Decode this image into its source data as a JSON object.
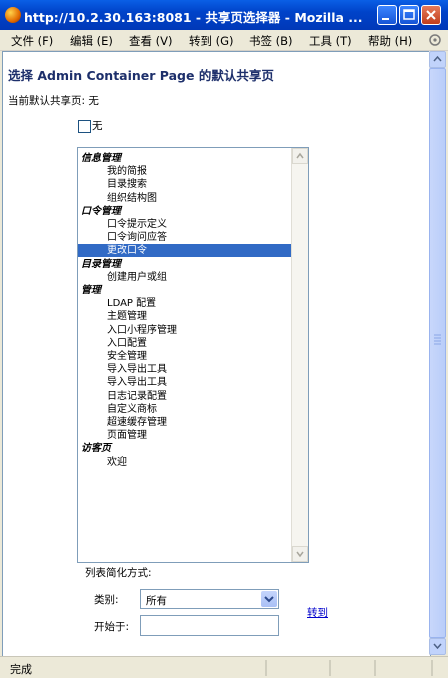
{
  "window": {
    "title": "http://10.2.30.163:8081 - 共享页选择器 - Mozilla ..."
  },
  "menu": [
    {
      "label": "文件 (F)"
    },
    {
      "label": "编辑 (E)"
    },
    {
      "label": "查看 (V)"
    },
    {
      "label": "转到 (G)"
    },
    {
      "label": "书签 (B)"
    },
    {
      "label": "工具 (T)"
    },
    {
      "label": "帮助 (H)"
    }
  ],
  "page": {
    "heading": "选择 Admin Container Page 的默认共享页",
    "current_default": "当前默认共享页: 无",
    "none_label": "无"
  },
  "list": [
    {
      "text": "信息管理",
      "kind": "group"
    },
    {
      "text": "我的简报",
      "kind": "child"
    },
    {
      "text": "目录搜索",
      "kind": "child"
    },
    {
      "text": "组织结构图",
      "kind": "child"
    },
    {
      "text": "口令管理",
      "kind": "group"
    },
    {
      "text": "口令提示定义",
      "kind": "child"
    },
    {
      "text": "口令询问应答",
      "kind": "child"
    },
    {
      "text": "更改口令",
      "kind": "child",
      "selected": true
    },
    {
      "text": "目录管理",
      "kind": "group"
    },
    {
      "text": "创建用户或组",
      "kind": "child"
    },
    {
      "text": "管理",
      "kind": "group"
    },
    {
      "text": "LDAP 配置",
      "kind": "child"
    },
    {
      "text": "主题管理",
      "kind": "child"
    },
    {
      "text": "入口小程序管理",
      "kind": "child"
    },
    {
      "text": "入口配置",
      "kind": "child"
    },
    {
      "text": "安全管理",
      "kind": "child"
    },
    {
      "text": "导入导出工具",
      "kind": "child"
    },
    {
      "text": "导入导出工具",
      "kind": "child"
    },
    {
      "text": "日志记录配置",
      "kind": "child"
    },
    {
      "text": "自定义商标",
      "kind": "child"
    },
    {
      "text": "超速缓存管理",
      "kind": "child"
    },
    {
      "text": "页面管理",
      "kind": "child"
    },
    {
      "text": "访客页",
      "kind": "group"
    },
    {
      "text": "欢迎",
      "kind": "child"
    }
  ],
  "filter": {
    "sort_label": "列表简化方式:",
    "category_label": "类别:",
    "category_value": "所有",
    "start_label": "开始于:",
    "start_value": "",
    "goto_label": "转到"
  },
  "status": {
    "text": "完成"
  },
  "colors": {
    "titlebar": "#0043c9",
    "selection": "#316ac5",
    "heading": "#1d2f6b",
    "link": "#0000cc"
  }
}
